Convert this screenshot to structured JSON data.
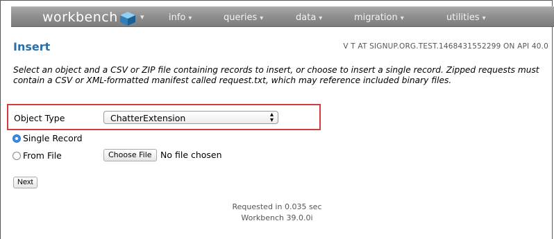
{
  "nav": {
    "brand": "workbench",
    "menus": [
      {
        "label": "info"
      },
      {
        "label": "queries"
      },
      {
        "label": "data"
      },
      {
        "label": "migration"
      },
      {
        "label": "utilities"
      }
    ]
  },
  "header": {
    "title": "Insert",
    "connection_info": "V T AT SIGNUP.ORG.TEST.1468431552299 ON API 40.0"
  },
  "instructions": "Select an object and a CSV or ZIP file containing records to insert, or choose to insert a single record. Zipped requests must contain a CSV or XML-formatted manifest called request.txt, which may reference included binary files.",
  "form": {
    "object_type_label": "Object Type",
    "object_type_value": "ChatterExtension",
    "options": [
      {
        "label": "Single Record",
        "checked": true
      },
      {
        "label": "From File",
        "checked": false
      }
    ],
    "choose_file_label": "Choose File",
    "no_file_text": "No file chosen",
    "next_label": "Next"
  },
  "footer": {
    "requested": "Requested in 0.035 sec",
    "version": "Workbench 39.0.0i"
  },
  "colors": {
    "title": "#2a6fa8",
    "highlight": "#d43c3c",
    "radio_selected": "#3b8ee3"
  }
}
